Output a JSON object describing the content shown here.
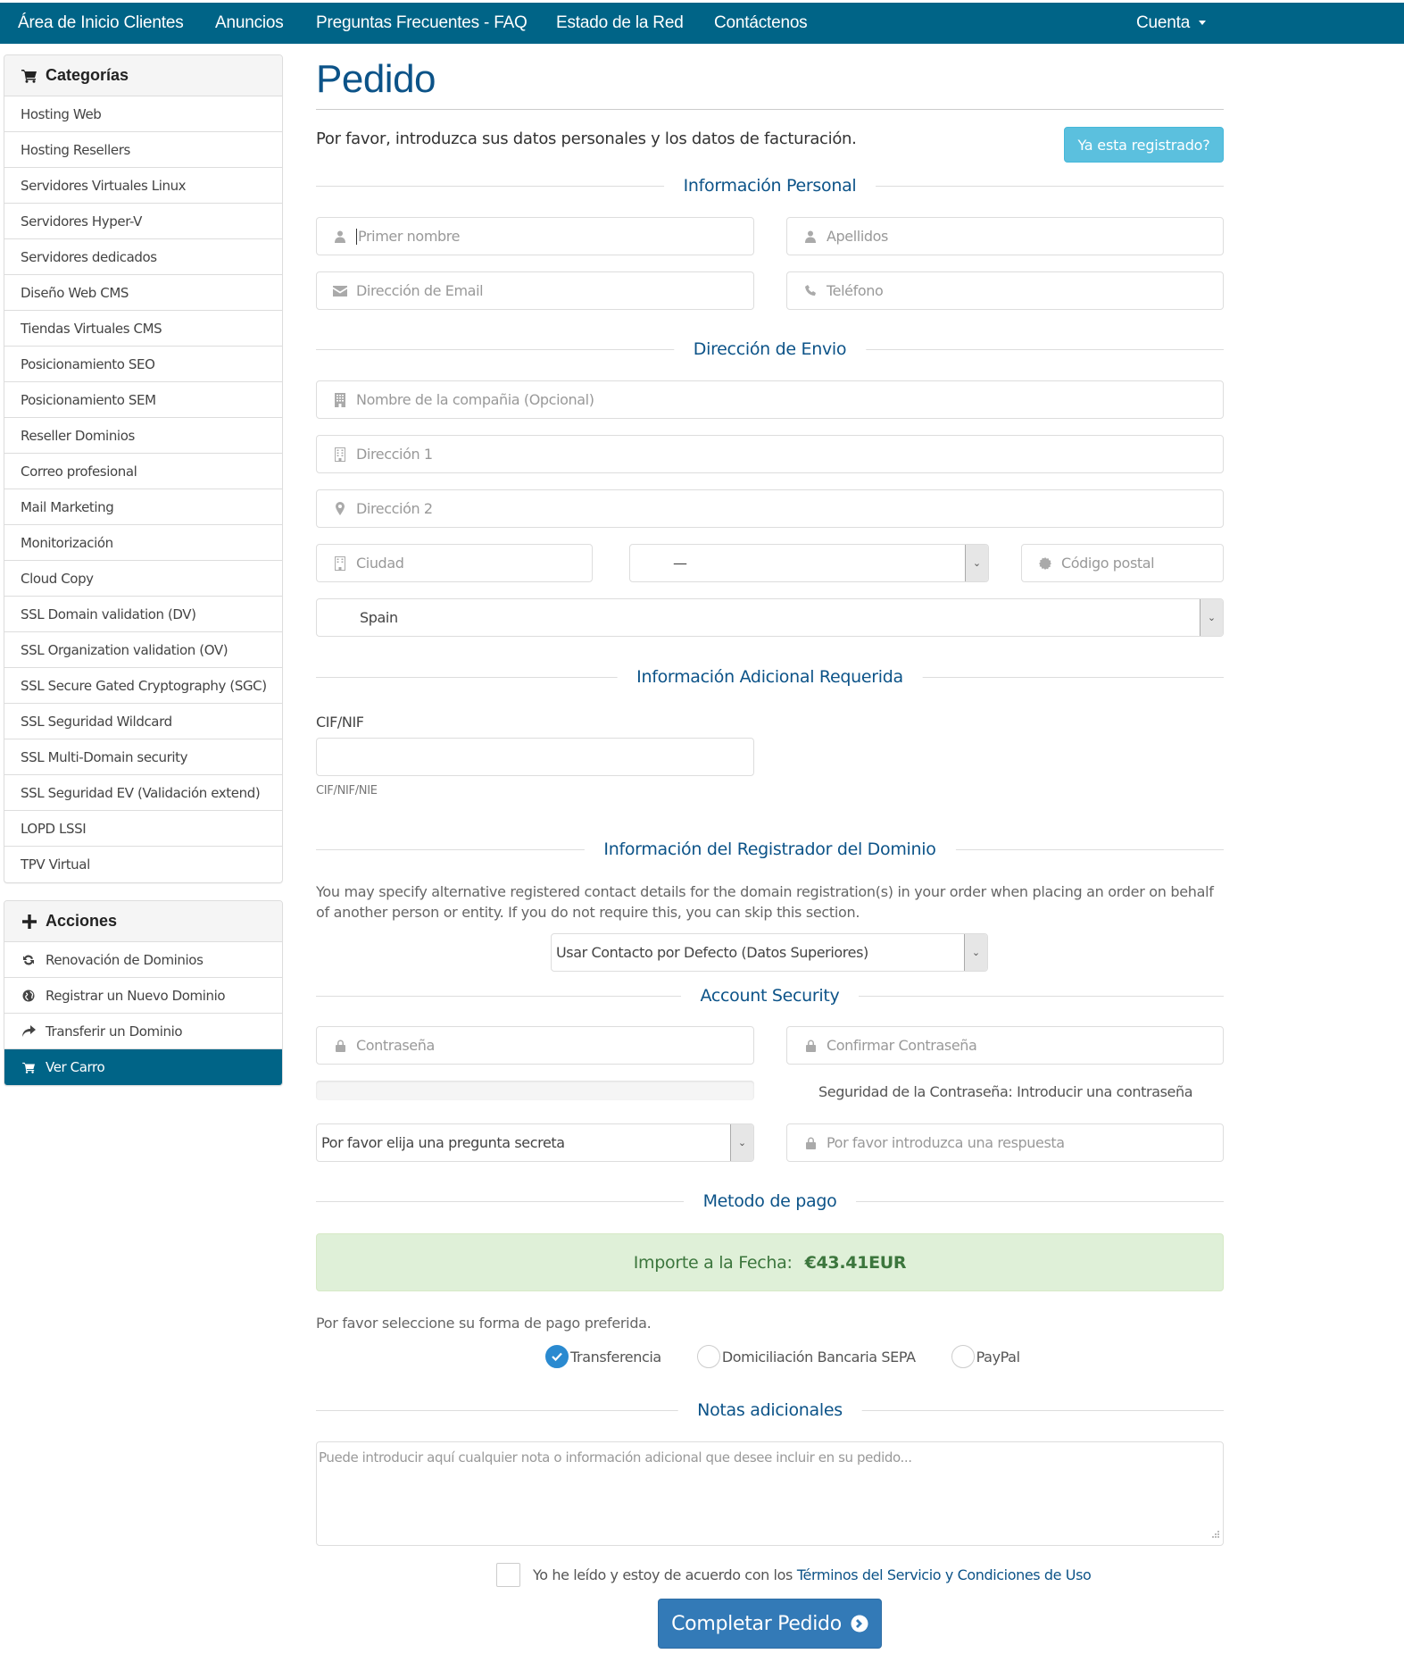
{
  "nav": {
    "items": [
      "Área de Inicio Clientes",
      "Anuncios",
      "Preguntas Frecuentes - FAQ",
      "Estado de la Red",
      "Contáctenos"
    ],
    "account": "Cuenta"
  },
  "sidebar": {
    "categories": {
      "title": "Categorías",
      "icon": "shopping-cart-icon",
      "items": [
        "Hosting Web",
        "Hosting Resellers",
        "Servidores Virtuales Linux",
        "Servidores Hyper-V",
        "Servidores dedicados",
        "Diseño Web CMS",
        "Tiendas Virtuales CMS",
        "Posicionamiento SEO",
        "Posicionamiento SEM",
        "Reseller Dominios",
        "Correo profesional",
        "Mail Marketing",
        "Monitorización",
        "Cloud Copy",
        "SSL Domain validation (DV)",
        "SSL Organization validation (OV)",
        "SSL Secure Gated Cryptography (SGC)",
        "SSL Seguridad Wildcard",
        "SSL Multi-Domain security",
        "SSL Seguridad EV (Validación extend)",
        "LOPD LSSI",
        "TPV Virtual"
      ]
    },
    "actions": {
      "title": "Acciones",
      "icon": "plus-icon",
      "items": [
        {
          "label": "Renovación de Dominios",
          "icon": "refresh-icon"
        },
        {
          "label": "Registrar un Nuevo Dominio",
          "icon": "globe-icon"
        },
        {
          "label": "Transferir un Dominio",
          "icon": "share-arrow-icon"
        },
        {
          "label": "Ver Carro",
          "icon": "shopping-cart-icon",
          "active": true
        }
      ]
    }
  },
  "main": {
    "title": "Pedido",
    "intro": "Por favor, introduzca sus datos personales y los datos de facturación.",
    "already_registered": "Ya esta registrado?",
    "sections": {
      "personal": "Información Personal",
      "shipping": "Dirección de Envio",
      "additional": "Información Adicional Requerida",
      "registrar": "Información del Registrador del Dominio",
      "security": "Account Security",
      "payment": "Metodo de pago",
      "notes": "Notas adicionales"
    },
    "personal": {
      "first_name": {
        "placeholder": "Primer nombre",
        "value": ""
      },
      "last_name": {
        "placeholder": "Apellidos",
        "value": ""
      },
      "email": {
        "placeholder": "Dirección de Email",
        "value": ""
      },
      "phone": {
        "placeholder": "Teléfono",
        "value": ""
      }
    },
    "shipping": {
      "company": {
        "placeholder": "Nombre de la compañia (Opcional)"
      },
      "address1": {
        "placeholder": "Dirección 1"
      },
      "address2": {
        "placeholder": "Dirección 2"
      },
      "city": {
        "placeholder": "Ciudad"
      },
      "state": {
        "selected": "—"
      },
      "postcode": {
        "placeholder": "Código postal"
      },
      "country": {
        "selected": "Spain"
      }
    },
    "additional": {
      "cif_label": "CIF/NIF",
      "cif_value": "",
      "cif_help": "CIF/NIF/NIE"
    },
    "registrar": {
      "description": "You may specify alternative registered contact details for the domain registration(s) in your order when placing an order on behalf of another person or entity. If you do not require this, you can skip this section.",
      "contact_select": "Usar Contacto por Defecto (Datos Superiores)"
    },
    "security": {
      "password": {
        "placeholder": "Contraseña"
      },
      "confirm_password": {
        "placeholder": "Confirmar Contraseña"
      },
      "strength_text": "Seguridad de la Contraseña: Introducir una contraseña",
      "strength_percent": 0,
      "question_select": "Por favor elija una pregunta secreta",
      "answer": {
        "placeholder": "Por favor introduzca una respuesta"
      }
    },
    "payment": {
      "amount_label": "Importe a la Fecha:",
      "amount_value": "€43.41EUR",
      "prompt": "Por favor seleccione su forma de pago preferida.",
      "methods": [
        {
          "label": "Transferencia",
          "checked": true
        },
        {
          "label": "Domiciliación Bancaria SEPA",
          "checked": false
        },
        {
          "label": "PayPal",
          "checked": false
        }
      ]
    },
    "notes": {
      "placeholder": "Puede introducir aquí cualquier nota o información adicional que desee incluir en su pedido..."
    },
    "tos": {
      "text": "Yo he leído y estoy de acuerdo con los",
      "link": "Términos del Servicio y Condiciones de Uso",
      "checked": false
    },
    "submit": "Completar Pedido"
  },
  "colors": {
    "nav_bg": "#006487",
    "title": "#0c5388",
    "info_button": "#5bc0de",
    "primary_button": "#337ab7",
    "success_bg": "#dff0d8",
    "success_text": "#3c763d",
    "radio_checked": "#2a8ad0"
  }
}
